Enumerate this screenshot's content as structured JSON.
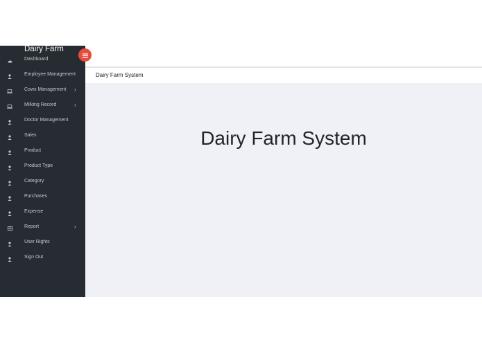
{
  "brand": "Dairy Farm",
  "accent_color": "#e74c3c",
  "sidebar_color": "#272c33",
  "menu": [
    {
      "label": "Dashboard",
      "icon": "dashboard-icon",
      "chevron": false
    },
    {
      "label": "Employee Management",
      "icon": "user-icon",
      "chevron": false
    },
    {
      "label": "Cows Management",
      "icon": "laptop-icon",
      "chevron": true
    },
    {
      "label": "Milking Record",
      "icon": "laptop-icon",
      "chevron": true
    },
    {
      "label": "Doctor Management",
      "icon": "user-icon",
      "chevron": false
    },
    {
      "label": "Sales",
      "icon": "user-icon",
      "chevron": false
    },
    {
      "label": "Product",
      "icon": "user-icon",
      "chevron": false
    },
    {
      "label": "Product Type",
      "icon": "user-icon",
      "chevron": false
    },
    {
      "label": "Category",
      "icon": "user-icon",
      "chevron": false
    },
    {
      "label": "Purchases",
      "icon": "user-icon",
      "chevron": false
    },
    {
      "label": "Expense",
      "icon": "user-icon",
      "chevron": false
    },
    {
      "label": "Report",
      "icon": "table-icon",
      "chevron": true
    },
    {
      "label": "User Rights",
      "icon": "user-icon",
      "chevron": false
    },
    {
      "label": "Sign Out",
      "icon": "user-icon",
      "chevron": false
    }
  ],
  "chevron_glyph": "›",
  "breadcrumb": "Dairy Farm System",
  "page_title": "Dairy Farm System"
}
